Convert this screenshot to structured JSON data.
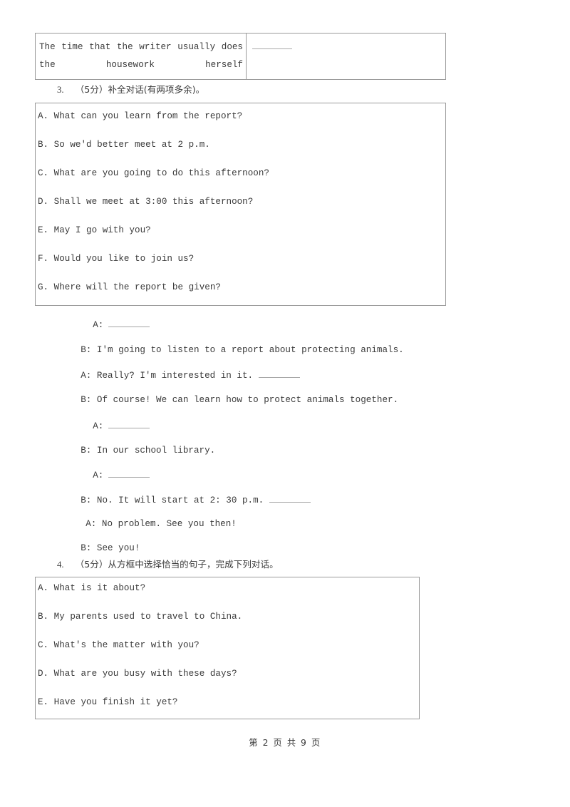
{
  "document": {
    "top_table": {
      "left_cell_text": "The time that the writer usually does the housework herself",
      "right_cell_blank": ""
    },
    "question3": {
      "number": "3.",
      "heading": "（5分）补全对话(有两项多余)。",
      "options": [
        "A. What can you learn from the report?",
        "B. So we'd better meet at 2 p.m.",
        "C. What are you going to do this afternoon?",
        "D. Shall we meet at 3:00 this afternoon?",
        "E. May I go with you?",
        "F. Would you like to join us?",
        "G. Where will the report be given?"
      ],
      "dialogue": [
        {
          "speaker": "A:",
          "pre": "",
          "blank_after": true,
          "post": "",
          "indent": "a"
        },
        {
          "speaker": "B:",
          "pre": " I'm going to listen to a report about protecting animals.",
          "blank_after": false,
          "post": "",
          "indent": "b"
        },
        {
          "speaker": "A:",
          "pre": " Really? I'm interested in it. ",
          "blank_after": true,
          "post": "",
          "indent": "b"
        },
        {
          "speaker": "B:",
          "pre": " Of course! We can learn how to protect animals together.",
          "blank_after": false,
          "post": "",
          "indent": "b"
        },
        {
          "speaker": "A:",
          "pre": "",
          "blank_after": true,
          "post": "",
          "indent": "a"
        },
        {
          "speaker": "B:",
          "pre": " In our school library.",
          "blank_after": false,
          "post": "",
          "indent": "b"
        },
        {
          "speaker": "A:",
          "pre": "",
          "blank_after": true,
          "post": "",
          "indent": "a"
        },
        {
          "speaker": "B:",
          "pre": " No. It will start at 2: 30 p.m. ",
          "blank_after": true,
          "post": "",
          "indent": "b"
        },
        {
          "speaker": "A:",
          "pre": " No problem. See you then!",
          "blank_after": false,
          "post": "",
          "indent": "a"
        },
        {
          "speaker": "B:",
          "pre": " See you!",
          "blank_after": false,
          "post": "",
          "indent": "b"
        }
      ]
    },
    "question4": {
      "number": "4.",
      "heading": "（5分）从方框中选择恰当的句子，完成下列对话。",
      "options": [
        "A. What is it about?",
        "B. My parents used to travel to China.",
        "C. What's the matter with you?",
        "D. What are you busy with these days?",
        "E. Have you finish it yet?"
      ]
    },
    "footer": "第 2 页 共 9 页"
  }
}
